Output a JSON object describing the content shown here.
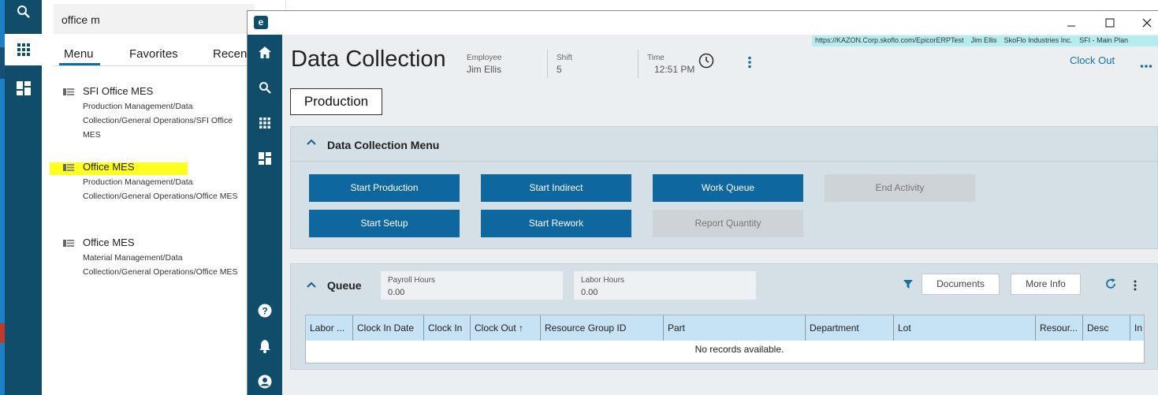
{
  "menu_panel": {
    "search_value": "office m",
    "tabs": [
      "Menu",
      "Favorites",
      "Recent"
    ],
    "items": [
      {
        "title": "SFI Office MES",
        "path": "Production Management/Data Collection/General Operations/SFI Office MES"
      },
      {
        "title": "Office MES",
        "path": "Production Management/Data Collection/General Operations/Office MES"
      },
      {
        "title": "Office MES",
        "path": "Material Management/Data Collection/General Operations/Office MES"
      }
    ]
  },
  "window": {
    "logo": "e",
    "url_bar": [
      "https://KAZON.Corp.skoflo.com/EpicorERPTest",
      "Jim Ellis",
      "SkoFlo Industries Inc.",
      "SFI - Main Plan"
    ]
  },
  "header": {
    "title": "Data Collection",
    "employee_label": "Employee",
    "employee_value": "Jim Ellis",
    "shift_label": "Shift",
    "shift_value": "5",
    "time_label": "Time",
    "time_value": "12:51 PM",
    "clock_out": "Clock Out"
  },
  "production_button": "Production",
  "data_collection_menu": {
    "title": "Data Collection Menu",
    "buttons": [
      {
        "label": "Start Production",
        "enabled": true
      },
      {
        "label": "Start Indirect",
        "enabled": true
      },
      {
        "label": "Work Queue",
        "enabled": true
      },
      {
        "label": "End Activity",
        "enabled": false
      },
      {
        "label": "Start Setup",
        "enabled": true
      },
      {
        "label": "Start Rework",
        "enabled": true
      },
      {
        "label": "Report Quantity",
        "enabled": false
      }
    ]
  },
  "queue": {
    "title": "Queue",
    "payroll_label": "Payroll Hours",
    "payroll_value": "0.00",
    "labor_label": "Labor Hours",
    "labor_value": "0.00",
    "documents": "Documents",
    "more_info": "More Info",
    "columns": [
      "Labor ...",
      "Clock In Date",
      "Clock In",
      "Clock Out ↑",
      "Resource Group ID",
      "Part",
      "Department",
      "Lot",
      "Resour...",
      "Desc",
      "In"
    ],
    "empty_text": "No records available."
  },
  "colors": {
    "rail": "#0f4d6b",
    "primary_button": "#0e679f",
    "card_bg": "#d5e0e6",
    "grid_header": "#c5e3f5",
    "highlight": "#ffff1f",
    "url_bar": "#b6ecee"
  }
}
